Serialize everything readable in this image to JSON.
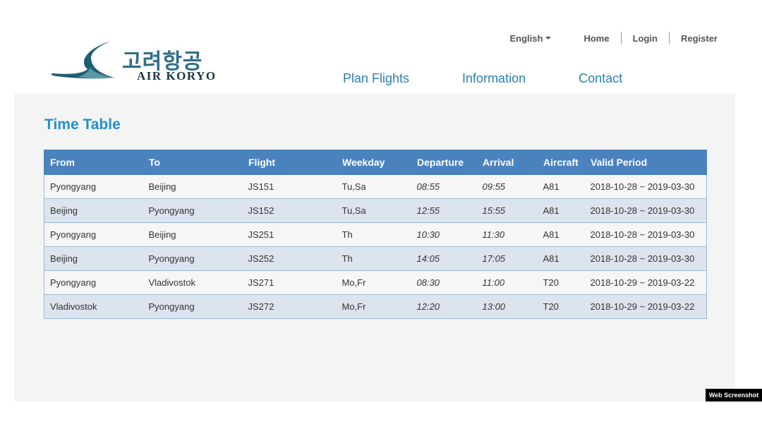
{
  "logo": {
    "korean": "고려항공",
    "english": "AIR KORYO"
  },
  "topbar": {
    "language": "English",
    "links": [
      "Home",
      "Login",
      "Register"
    ]
  },
  "nav": [
    "Plan Flights",
    "Information",
    "Contact"
  ],
  "page_title": "Time Table",
  "table": {
    "headers": [
      "From",
      "To",
      "Flight",
      "Weekday",
      "Departure",
      "Arrival",
      "Aircraft",
      "Valid Period"
    ],
    "rows": [
      [
        "Pyongyang",
        "Beijing",
        "JS151",
        "Tu,Sa",
        "08:55",
        "09:55",
        "A81",
        "2018-10-28 ~ 2019-03-30"
      ],
      [
        "Beijing",
        "Pyongyang",
        "JS152",
        "Tu,Sa",
        "12:55",
        "15:55",
        "A81",
        "2018-10-28 ~ 2019-03-30"
      ],
      [
        "Pyongyang",
        "Beijing",
        "JS251",
        "Th",
        "10:30",
        "11:30",
        "A81",
        "2018-10-28 ~ 2019-03-30"
      ],
      [
        "Beijing",
        "Pyongyang",
        "JS252",
        "Th",
        "14:05",
        "17:05",
        "A81",
        "2018-10-28 ~ 2019-03-30"
      ],
      [
        "Pyongyang",
        "Vladivostok",
        "JS271",
        "Mo,Fr",
        "08:30",
        "11:00",
        "T20",
        "2018-10-29 ~ 2019-03-22"
      ],
      [
        "Vladivostok",
        "Pyongyang",
        "JS272",
        "Mo,Fr",
        "12:20",
        "13:00",
        "T20",
        "2018-10-29 ~ 2019-03-22"
      ]
    ]
  },
  "watermark": "Web Screenshot",
  "colors": {
    "header_row": "#4a82be",
    "title": "#2590c9",
    "nav_link": "#2b7fac",
    "row_alt": "#dce4ee",
    "panel_bg": "#f4f4f4"
  },
  "icons": {
    "logo_mark": "crane-wing-logo-icon",
    "language_dropdown": "caret-down-icon"
  }
}
